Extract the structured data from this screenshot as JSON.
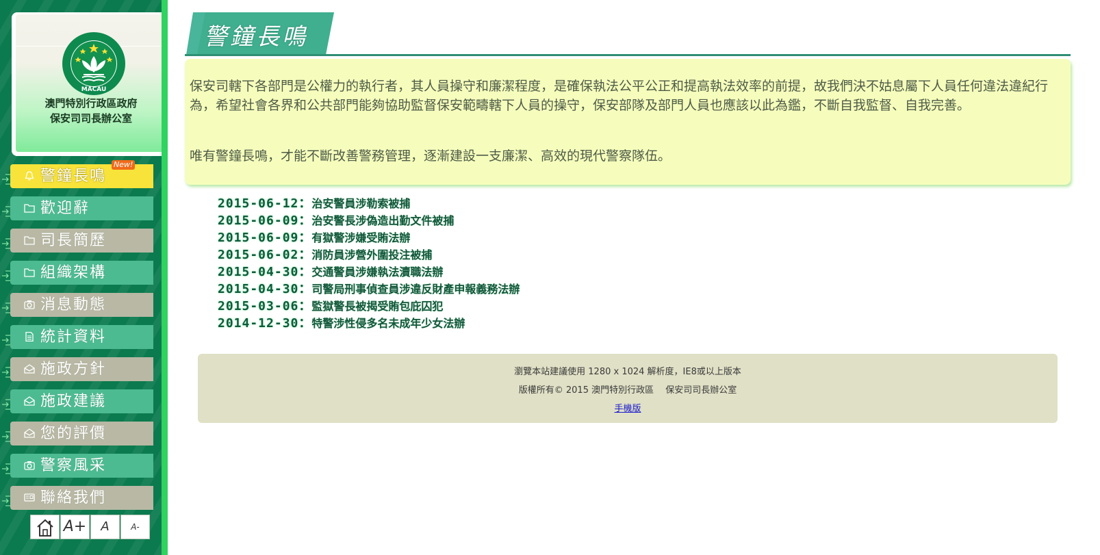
{
  "org": {
    "line1": "澳門特別行政區政府",
    "line2": "保安司司長辦公室",
    "emblem_text": "MACAU"
  },
  "menu": [
    {
      "label": "警鐘長鳴",
      "icon": "bell-icon",
      "style": "active",
      "badge": "New!"
    },
    {
      "label": "歡迎辭",
      "icon": "folder-icon",
      "style": "green"
    },
    {
      "label": "司長簡歷",
      "icon": "folder-icon",
      "style": "gray"
    },
    {
      "label": "組織架構",
      "icon": "folder-icon",
      "style": "green"
    },
    {
      "label": "消息動態",
      "icon": "camera-icon",
      "style": "gray"
    },
    {
      "label": "統計資料",
      "icon": "document-icon",
      "style": "green"
    },
    {
      "label": "施政方針",
      "icon": "envelope-icon",
      "style": "gray"
    },
    {
      "label": "施政建議",
      "icon": "envelope-icon",
      "style": "green"
    },
    {
      "label": "您的評價",
      "icon": "envelope-icon",
      "style": "gray"
    },
    {
      "label": "警察風采",
      "icon": "camera-icon",
      "style": "green"
    },
    {
      "label": "聯絡我們",
      "icon": "card-icon",
      "style": "gray"
    }
  ],
  "tools": {
    "home": "home-icon",
    "font_increase": "A+",
    "font_normal": "A",
    "font_decrease": "A-"
  },
  "page": {
    "title": "警鐘長鳴",
    "intro_1": "保安司轄下各部門是公權力的執行者，其人員操守和廉潔程度，是確保執法公平公正和提高執法效率的前提，故我們決不姑息屬下人員任何違法違紀行為，希望社會各界和公共部門能夠協助監督保安範疇轄下人員的操守，保安部隊及部門人員也應該以此為鑑，不斷自我監督、自我完善。",
    "intro_2": "唯有警鐘長鳴，才能不斷改善警務管理，逐漸建設一支廉潔、高效的現代警察隊伍。"
  },
  "news": [
    {
      "date": "2015-06-12",
      "title": "治安警員涉勒索被捕"
    },
    {
      "date": "2015-06-09",
      "title": "治安警長涉偽造出勤文件被捕"
    },
    {
      "date": "2015-06-09",
      "title": "有獄警涉嫌受賄法辦"
    },
    {
      "date": "2015-06-02",
      "title": "消防員涉營外圍投注被捕"
    },
    {
      "date": "2015-04-30",
      "title": "交通警員涉嫌執法瀆職法辦"
    },
    {
      "date": "2015-04-30",
      "title": "司警局刑事偵查員涉違反財產申報義務法辦"
    },
    {
      "date": "2015-03-06",
      "title": "監獄警長被揭受賄包庇囚犯"
    },
    {
      "date": "2014-12-30",
      "title": "特警涉性侵多名未成年少女法辦"
    }
  ],
  "news_separator": "：",
  "footer": {
    "line1": "瀏覽本站建議使用 1280 x 1024 解析度，IE8或以上版本",
    "line2": "版權所有© 2015 澳門特別行政區　 保安司司長辦公室",
    "mobile_link": "手機版"
  },
  "colors": {
    "sidebar_bg": "#0b7a4e",
    "menu_green": "#4dbb92",
    "menu_gray": "#b8b8a4",
    "menu_active": "#f7e33a",
    "title_tab": "#3faf8f",
    "intro_bg": "#f6fdbc",
    "footer_bg": "#e0e0c6"
  }
}
